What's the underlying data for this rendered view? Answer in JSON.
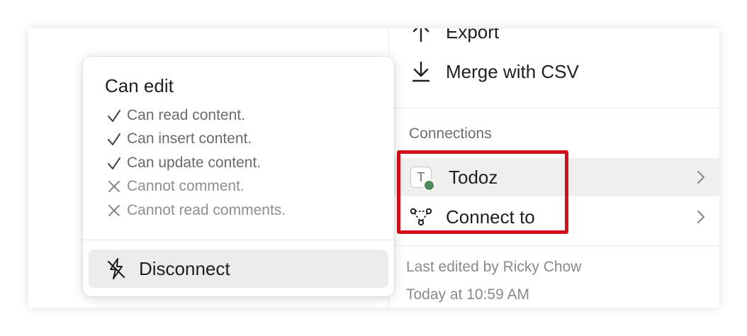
{
  "menu": {
    "export_label": "Export",
    "merge_label": "Merge with CSV",
    "connections_heading": "Connections",
    "connections": [
      {
        "label": "Todoz",
        "avatar_letter": "T",
        "status_color": "#4d8b5a"
      },
      {
        "label": "Connect to"
      }
    ],
    "footer": {
      "edited_by": "Last edited by Ricky Chow",
      "edited_time": "Today at 10:59 AM"
    }
  },
  "popover": {
    "title": "Can edit",
    "permissions": [
      {
        "label": "Can read content.",
        "allowed": true
      },
      {
        "label": "Can insert content.",
        "allowed": true
      },
      {
        "label": "Can update content.",
        "allowed": true
      },
      {
        "label": "Cannot comment.",
        "allowed": false
      },
      {
        "label": "Cannot read comments.",
        "allowed": false
      }
    ],
    "disconnect_label": "Disconnect"
  },
  "colors": {
    "highlight_border": "#d3101b",
    "hover_bg": "#efefed",
    "status_dot": "#4d8b5a"
  }
}
